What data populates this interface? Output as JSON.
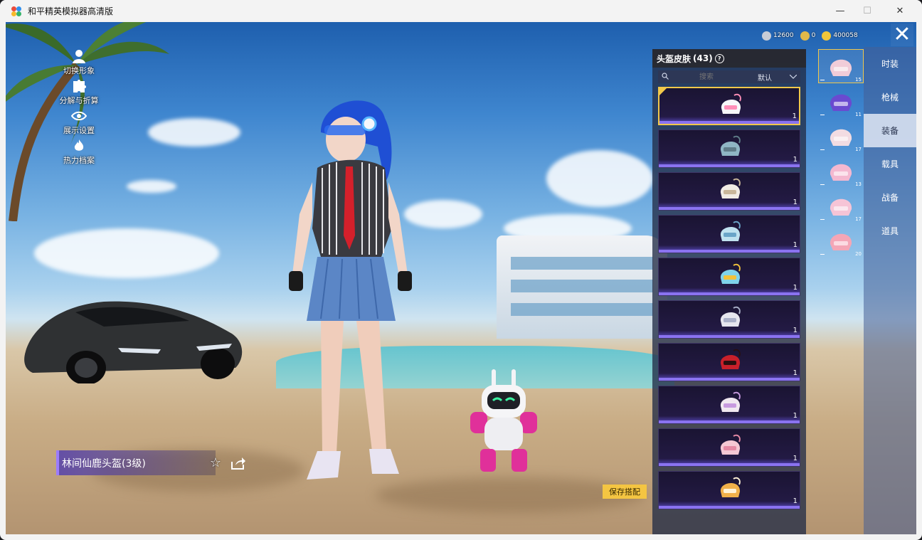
{
  "window": {
    "title": "和平精英模拟器高清版",
    "minimize_glyph": "—",
    "maximize_glyph": "☐",
    "close_glyph": "✕"
  },
  "left_menu": [
    {
      "label": "切换形象",
      "icon": "person-icon"
    },
    {
      "label": "分解与折算",
      "icon": "puzzle-icon"
    },
    {
      "label": "展示设置",
      "icon": "eye-icon"
    },
    {
      "label": "热力档案",
      "icon": "flame-icon"
    }
  ],
  "currency": [
    {
      "icon": "ag-coin-icon",
      "value": "12600",
      "color": "#c8ccd6"
    },
    {
      "icon": "a-coin-icon",
      "value": "0",
      "color": "#e0b94a"
    },
    {
      "icon": "gold-coin-icon",
      "value": "400058",
      "color": "#f0c63a"
    }
  ],
  "panel": {
    "title": "头盔皮肤",
    "count": "(43)",
    "help_glyph": "?",
    "search_placeholder": "搜索",
    "sort_value": "默认"
  },
  "skins": [
    {
      "qty": "1",
      "selected": true,
      "color": "#f7f7f9",
      "accent": "#ff8fb8"
    },
    {
      "qty": "1",
      "selected": false,
      "color": "#8fb6c4",
      "accent": "#5f7c88"
    },
    {
      "qty": "1",
      "selected": false,
      "color": "#f1ece4",
      "accent": "#c9b79a"
    },
    {
      "qty": "1",
      "selected": false,
      "color": "#bfe2ef",
      "accent": "#6aa5c8"
    },
    {
      "qty": "1",
      "selected": false,
      "color": "#7fd3ea",
      "accent": "#f2c23a"
    },
    {
      "qty": "1",
      "selected": false,
      "color": "#e6e6ee",
      "accent": "#aab0c8"
    },
    {
      "qty": "1",
      "selected": false,
      "color": "#c8202a",
      "accent": "#2a1010"
    },
    {
      "qty": "1",
      "selected": false,
      "color": "#f0e8f0",
      "accent": "#c79adf"
    },
    {
      "qty": "1",
      "selected": false,
      "color": "#f5c8d4",
      "accent": "#e58aa5"
    },
    {
      "qty": "1",
      "selected": false,
      "color": "#f0b04a",
      "accent": "#fff2d6"
    }
  ],
  "category_thumbs": [
    {
      "num": "15",
      "color": "#f1ccd8"
    },
    {
      "num": "11",
      "color": "#6a4ad0"
    },
    {
      "num": "17",
      "color": "#f2dce2"
    },
    {
      "num": "13",
      "color": "#f4b8d0"
    },
    {
      "num": "17",
      "color": "#f6c4d6"
    },
    {
      "num": "20",
      "color": "#f4a6b6"
    }
  ],
  "right_tabs": [
    {
      "label": "时装",
      "active": false
    },
    {
      "label": "枪械",
      "active": false
    },
    {
      "label": "装备",
      "active": true
    },
    {
      "label": "载具",
      "active": false
    },
    {
      "label": "战备",
      "active": false
    },
    {
      "label": "道具",
      "active": false
    }
  ],
  "item_name": "林间仙鹿头盔(3级)",
  "save_button": "保存搭配",
  "close_glyph": "✕"
}
